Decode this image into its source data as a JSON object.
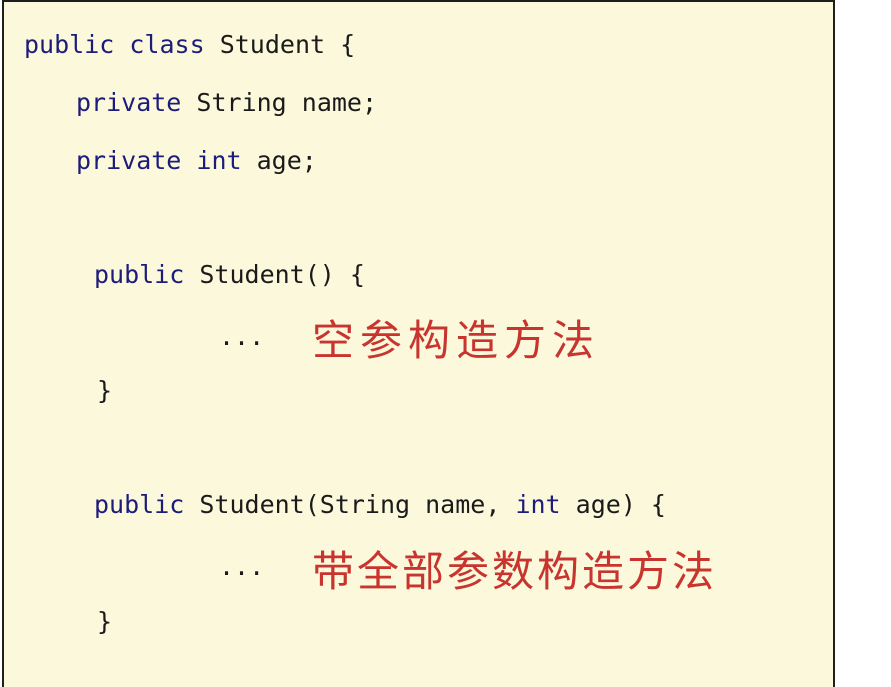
{
  "code": {
    "line1": {
      "kw1": "public",
      "kw2": "class",
      "rest": " Student {"
    },
    "line2": {
      "kw": "private",
      "rest": " String name;"
    },
    "line3": {
      "kw1": "private",
      "kw2": "int",
      "rest": " age;"
    },
    "ctor1": {
      "kw": "public",
      "rest": " Student() {"
    },
    "ctor1_body": "...",
    "ctor1_close": "}",
    "ctor2": {
      "kw": "public",
      "mid": " Student(String name, ",
      "kw2": "int",
      "rest": " age) {"
    },
    "ctor2_body": "...",
    "ctor2_close": "}"
  },
  "annotations": {
    "empty_ctor": "空参构造方法",
    "full_ctor": "带全部参数构造方法"
  },
  "colors": {
    "background": "#fbf8dc",
    "keyword": "#1c1c7a",
    "text": "#1a1a1a",
    "annotation": "#c8342e"
  }
}
